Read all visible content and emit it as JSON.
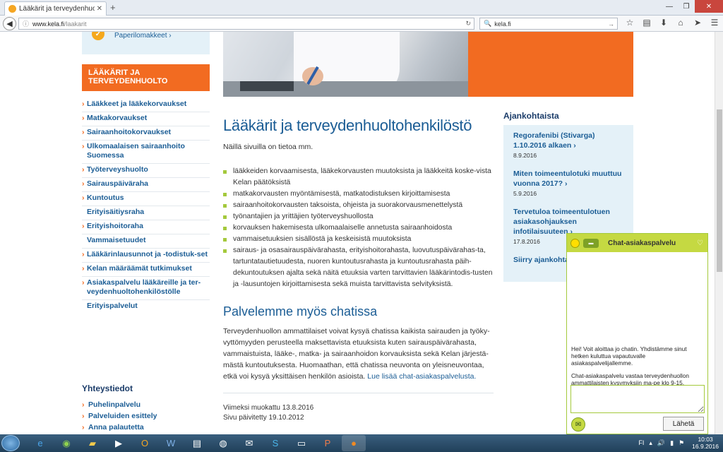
{
  "browser": {
    "tab_title": "Lääkärit ja terveydenhuolt...",
    "url_domain": "www.kela.fi",
    "url_path": "/laakarit",
    "search_text": "kela.fi"
  },
  "sidebar": {
    "paper_forms_link": "Paperilomakkeet ›",
    "header": "LÄÄKÄRIT JA TERVEYDENHUOLTO",
    "items": [
      {
        "label": "Lääkkeet ja lääkekorvaukset",
        "chevron": true
      },
      {
        "label": "Matkakorvaukset",
        "chevron": true
      },
      {
        "label": "Sairaanhoitokorvaukset",
        "chevron": true
      },
      {
        "label": "Ulkomaalaisen sairaanhoito Suomessa",
        "chevron": true
      },
      {
        "label": "Työterveyshuolto",
        "chevron": true
      },
      {
        "label": "Sairauspäiväraha",
        "chevron": true
      },
      {
        "label": "Kuntoutus",
        "chevron": true
      },
      {
        "label": "Erityisäitiysraha",
        "chevron": false
      },
      {
        "label": "Erityishoitoraha",
        "chevron": true
      },
      {
        "label": "Vammaisetuudet",
        "chevron": false
      },
      {
        "label": "Lääkärinlausunnot ja -todistuk-set",
        "chevron": true
      },
      {
        "label": "Kelan määräämät tutkimukset",
        "chevron": true
      },
      {
        "label": "Asiakaspalvelu lääkäreille ja ter-veydenhuoltohenkilöstölle",
        "chevron": true
      },
      {
        "label": "Erityispalvelut",
        "chevron": false
      }
    ],
    "contact_title": "Yhteystiedot",
    "contact_links": [
      "Puhelinpalvelu",
      "Palveluiden esittely",
      "Anna palautetta"
    ]
  },
  "main": {
    "title": "Lääkärit ja terveydenhuoltohenkilöstö",
    "intro": "Näillä sivuilla on tietoa mm.",
    "bullets": [
      "lääkkeiden korvaamisesta, lääkekorvausten muutoksista ja lääkkeitä koske-vista Kelan päätöksistä",
      "matkakorvausten myöntämisestä, matkatodistuksen kirjoittamisesta",
      "sairaanhoitokorvausten taksoista, ohjeista ja suorakorvausmenettelystä",
      "työnantajien ja yrittäjien työterveyshuollosta",
      "korvauksen hakemisesta ulkomaalaiselle annetusta sairaanhoidosta",
      "vammaisetuuksien sisällöstä ja keskeisistä muutoksista",
      "sairaus- ja osasairauspäivärahasta, erityishoitorahasta, luovutuspäivärahas-ta, tartuntatautietuudesta, nuoren kuntoutusrahasta ja kuntoutusrahasta päih-dekuntoutuksen ajalta sekä näitä etuuksia varten tarvittavien lääkärintodis-tusten ja -lausuntojen kirjoittamisesta sekä muista tarvittavista selvityksistä."
    ],
    "chat_title": "Palvelemme myös chatissa",
    "chat_para": "Terveydenhuollon ammattilaiset voivat kysyä chatissa kaikista sairauden ja työky-vyttömyyden perusteella maksettavista etuuksista kuten sairauspäivärahasta, vammaistuista, lääke-, matka- ja sairaanhoidon korvauksista sekä Kelan järjestä-mästä kuntoutuksesta. Huomaathan, että chatissa neuvonta on yleisneuvontaa, etkä voi kysyä yksittäisen henkilön asioista.",
    "chat_link": "Lue lisää chat-asiakaspalvelusta.",
    "modified": "Viimeksi muokattu 13.8.2016",
    "updated": "Sivu päivitetty 19.10.2012"
  },
  "news": {
    "title": "Ajankohtaista",
    "items": [
      {
        "title": "Regorafenibi (Stivarga) 1.10.2016 alkaen ›",
        "date": "8.9.2016"
      },
      {
        "title": "Miten toimeentulotuki muuttuu vuonna 2017? ›",
        "date": "5.9.2016"
      },
      {
        "title": "Tervetuloa toimeentulotuen asiakasohjauksen infotilaisuuteen ›",
        "date": "17.8.2016"
      }
    ],
    "more_link": "Siirry ajankohtaisiin ›"
  },
  "chat_widget": {
    "title": "Chat-asiakaspalvelu",
    "message1": "Hei! Voit aloittaa jo chatin. Yhdistämme sinut hetken kuluttua vapautuvalle asiakaspalvelijallemme.",
    "message2": "Chat-asiakaspalvelu vastaa terveydenhuollon ammattilaisten kysymyksiin ma-pe klo 9-15.",
    "send_label": "Lähetä"
  },
  "taskbar": {
    "lang": "FI",
    "time": "10:03",
    "date": "16.9.2016"
  },
  "colors": {
    "orange": "#f26b21",
    "blue": "#1b5d95",
    "lightblue": "#e4f1f8",
    "green": "#c5d942"
  }
}
